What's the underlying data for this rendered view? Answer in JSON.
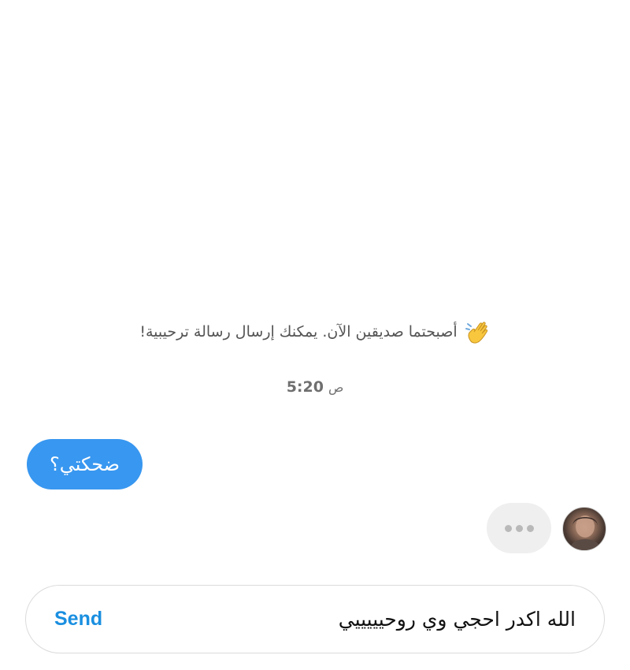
{
  "thread": {
    "system_note": "أصبحتما صديقين الآن. يمكنك إرسال رسالة ترحيبية!",
    "system_note_icon": "waving-hand-icon",
    "timestamp": {
      "time": "5:20",
      "suffix": "ص"
    },
    "messages": [
      {
        "direction": "sent",
        "text": "ضحكتي؟"
      }
    ],
    "typing_indicator": {
      "visible": true,
      "icon": "typing-dots-icon"
    }
  },
  "composer": {
    "value": "الله اكدر احجي وي روحيييييي",
    "send_label": "Send"
  },
  "colors": {
    "sent_bubble": "#3897f0",
    "send_button": "#1a8fe0",
    "typing_bubble": "#efefef"
  }
}
